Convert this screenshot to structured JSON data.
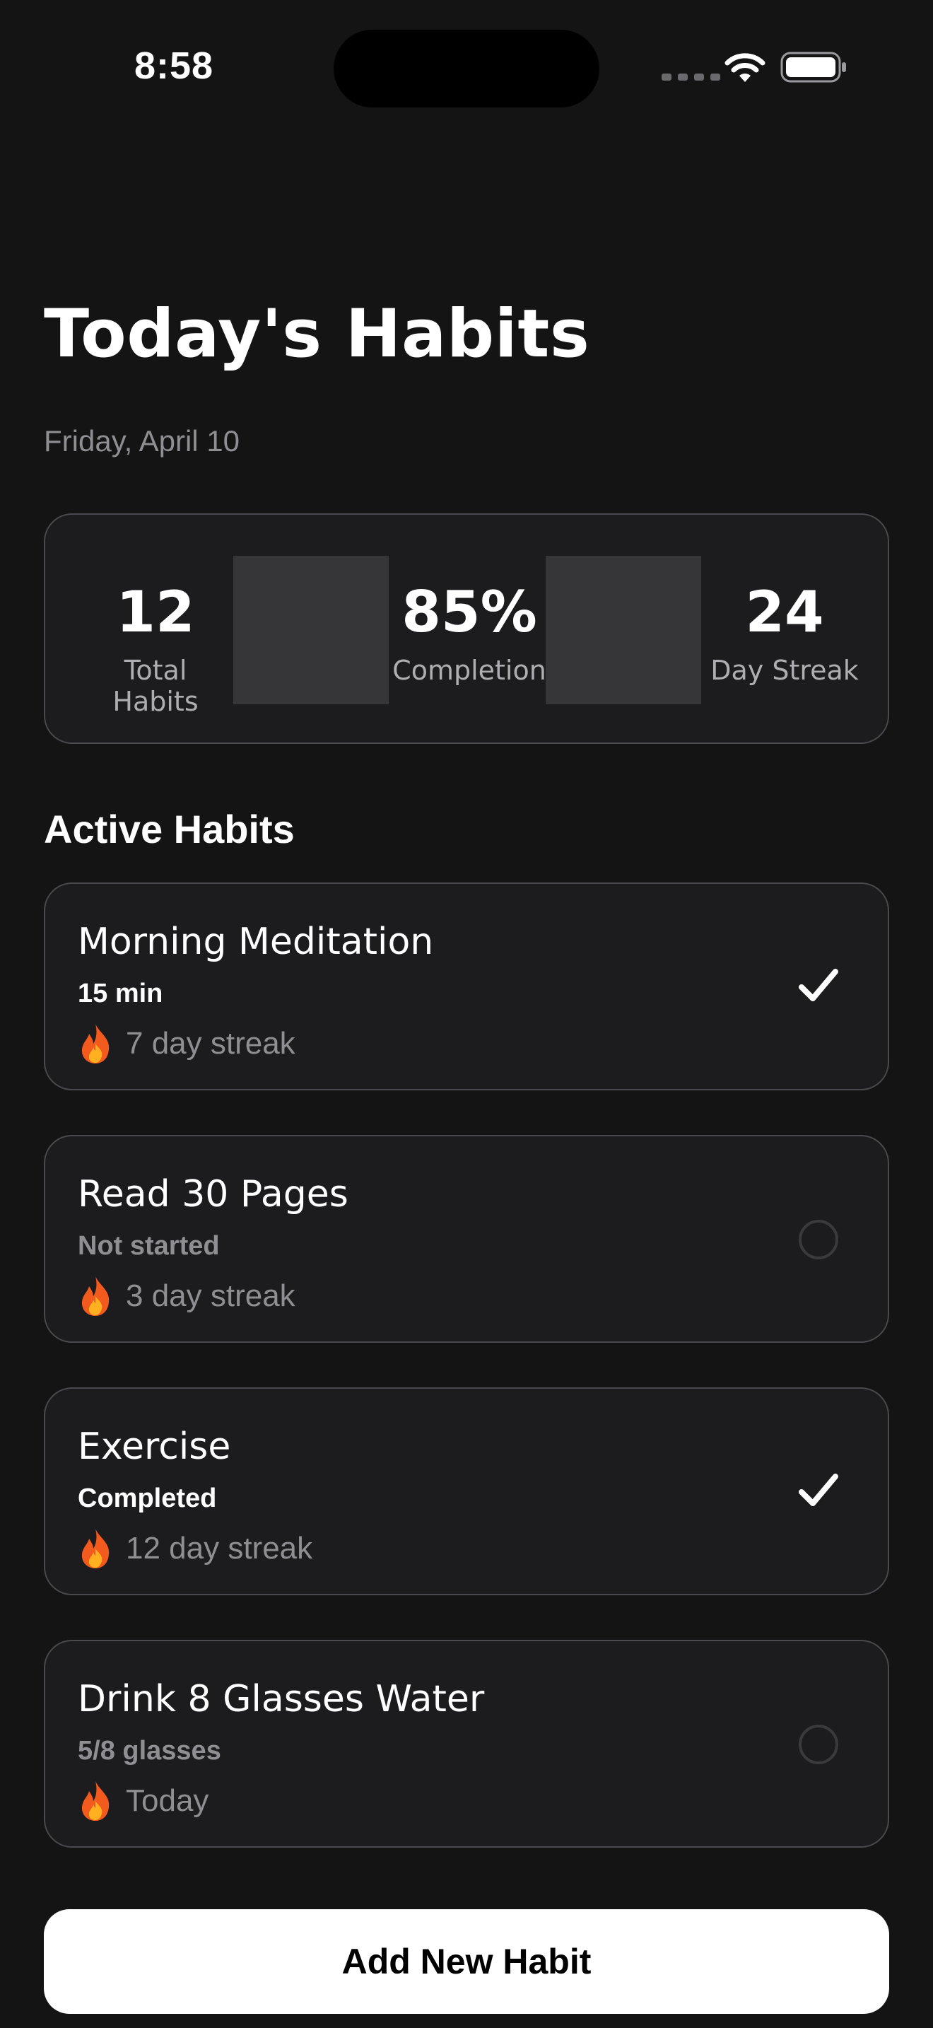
{
  "status_bar": {
    "time": "8:58"
  },
  "header": {
    "title": "Today's Habits",
    "date": "Friday, April 10"
  },
  "stats": [
    {
      "value": "12",
      "label": "Total Habits"
    },
    {
      "value": "85%",
      "label": "Completion"
    },
    {
      "value": "24",
      "label": "Day Streak"
    }
  ],
  "section": {
    "title": "Active Habits"
  },
  "habits": [
    {
      "name": "Morning Meditation",
      "status": "15 min",
      "streak": "7 day streak",
      "completed": true
    },
    {
      "name": "Read 30 Pages",
      "status": "Not started",
      "streak": "3 day streak",
      "completed": false
    },
    {
      "name": "Exercise",
      "status": "Completed",
      "streak": "12 day streak",
      "completed": true
    },
    {
      "name": "Drink 8 Glasses Water",
      "status": "5/8 glasses",
      "streak": "Today",
      "completed": false
    }
  ],
  "add_button": {
    "label": "Add New Habit"
  },
  "colors": {
    "background": "#141415",
    "card": "#1c1c1e",
    "card_border": "#4a4a4e",
    "muted_text": "#8e8e93"
  },
  "icons": [
    "wifi-icon",
    "battery-icon",
    "flame-icon",
    "checkmark-icon",
    "empty-circle-icon"
  ]
}
